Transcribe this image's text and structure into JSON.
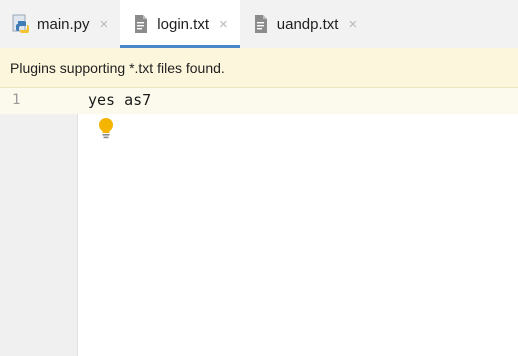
{
  "tabs": [
    {
      "label": "main.py",
      "icon": "python-file-icon",
      "active": false
    },
    {
      "label": "login.txt",
      "icon": "text-file-icon",
      "active": true
    },
    {
      "label": "uandp.txt",
      "icon": "text-file-icon",
      "active": false
    }
  ],
  "close_glyph": "×",
  "banner": {
    "message": "Plugins supporting *.txt files found."
  },
  "editor": {
    "line_number": "1",
    "code": "yes as7",
    "intention_icon": "lightbulb-icon"
  },
  "colors": {
    "active_tab_underline": "#4a88c7",
    "banner_background": "#fcf6dc",
    "lightbulb": "#f4b400"
  }
}
